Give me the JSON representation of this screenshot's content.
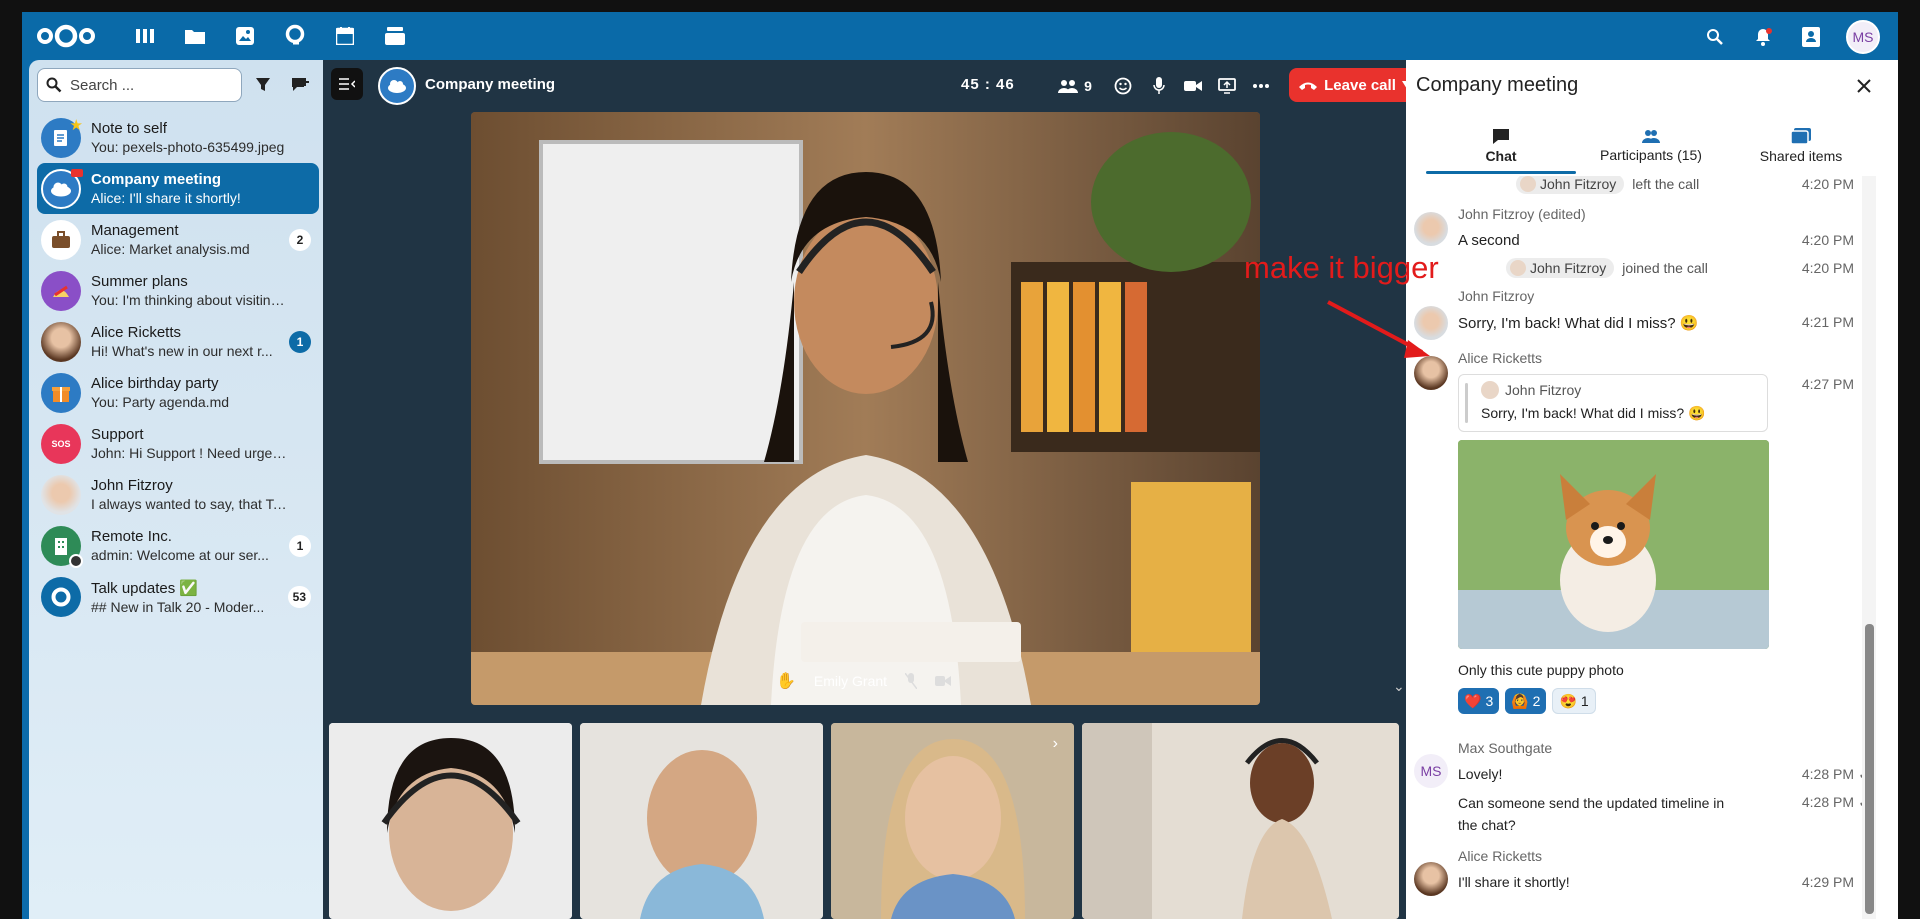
{
  "topbar": {
    "apps": [
      "dashboard-icon",
      "files-icon",
      "photos-icon",
      "talk-icon",
      "calendar-icon",
      "deck-icon"
    ],
    "user_initials": "MS"
  },
  "sidebar": {
    "search_placeholder": "Search ...",
    "conversations": [
      {
        "name": "Note to self",
        "preview": "You: pexels-photo-635499.jpeg",
        "badge": ""
      },
      {
        "name": "Company meeting",
        "preview": "Alice: I'll share it shortly!",
        "badge": "",
        "active": true
      },
      {
        "name": "Management",
        "preview": "Alice: Market analysis.md",
        "badge": "2"
      },
      {
        "name": "Summer plans",
        "preview": "You: I'm thinking about visiting A...",
        "badge": ""
      },
      {
        "name": "Alice Ricketts",
        "preview": "Hi! What's new in our next r...",
        "badge": "1"
      },
      {
        "name": "Alice birthday party",
        "preview": "You: Party agenda.md",
        "badge": ""
      },
      {
        "name": "Support",
        "preview": "John: Hi Support ! Need urgent h...",
        "badge": ""
      },
      {
        "name": "John Fitzroy",
        "preview": "I always wanted to say, that Talk ...",
        "badge": ""
      },
      {
        "name": "Remote Inc.",
        "preview": "admin: Welcome at our ser...",
        "badge": "1"
      },
      {
        "name": "Talk updates ✅",
        "preview": "## New in Talk 20 - Moder...",
        "badge": "53"
      }
    ]
  },
  "call": {
    "title": "Company meeting",
    "timer": "45 : 46",
    "participants_count": "9",
    "leave_label": "Leave call",
    "speaker_name": "Emily Grant"
  },
  "chat": {
    "title": "Company meeting",
    "tabs": [
      {
        "label": "Chat"
      },
      {
        "label": "Participants (15)"
      },
      {
        "label": "Shared items"
      }
    ],
    "sys1_name": "John Fitzroy",
    "sys1_text": "left the call",
    "sys1_time": "4:20 PM",
    "m1_author": "John Fitzroy (edited)",
    "m1_text": "A second",
    "m1_time": "4:20 PM",
    "sys2_name": "John Fitzroy",
    "sys2_text": "joined the call",
    "sys2_time": "4:20 PM",
    "m2_author": "John Fitzroy",
    "m2_text": "Sorry, I'm back! What did I miss? 😃",
    "m2_time": "4:21 PM",
    "m3_author": "Alice Ricketts",
    "m3_time": "4:27 PM",
    "quote_author": "John Fitzroy",
    "quote_text": "Sorry, I'm back! What did I miss? 😃",
    "m3_caption": "Only this cute puppy photo",
    "reactions": [
      {
        "emoji": "❤️",
        "count": "3"
      },
      {
        "emoji": "🙆",
        "count": "2"
      },
      {
        "emoji": "😍",
        "count": "1"
      }
    ],
    "m4_author": "Max Southgate",
    "m4_initials": "MS",
    "m4_text": "Lovely!",
    "m4_time": "4:28 PM",
    "m5_text": "Can someone send the updated timeline in the chat?",
    "m5_time": "4:28 PM",
    "m6_author": "Alice Ricketts",
    "m6_text": "I'll share it shortly!",
    "m6_time": "4:29 PM"
  },
  "annotation": "make it bigger",
  "colors": {
    "brand": "#0a6aa8",
    "leave": "#e9322d",
    "annotation": "#e21b1b"
  }
}
